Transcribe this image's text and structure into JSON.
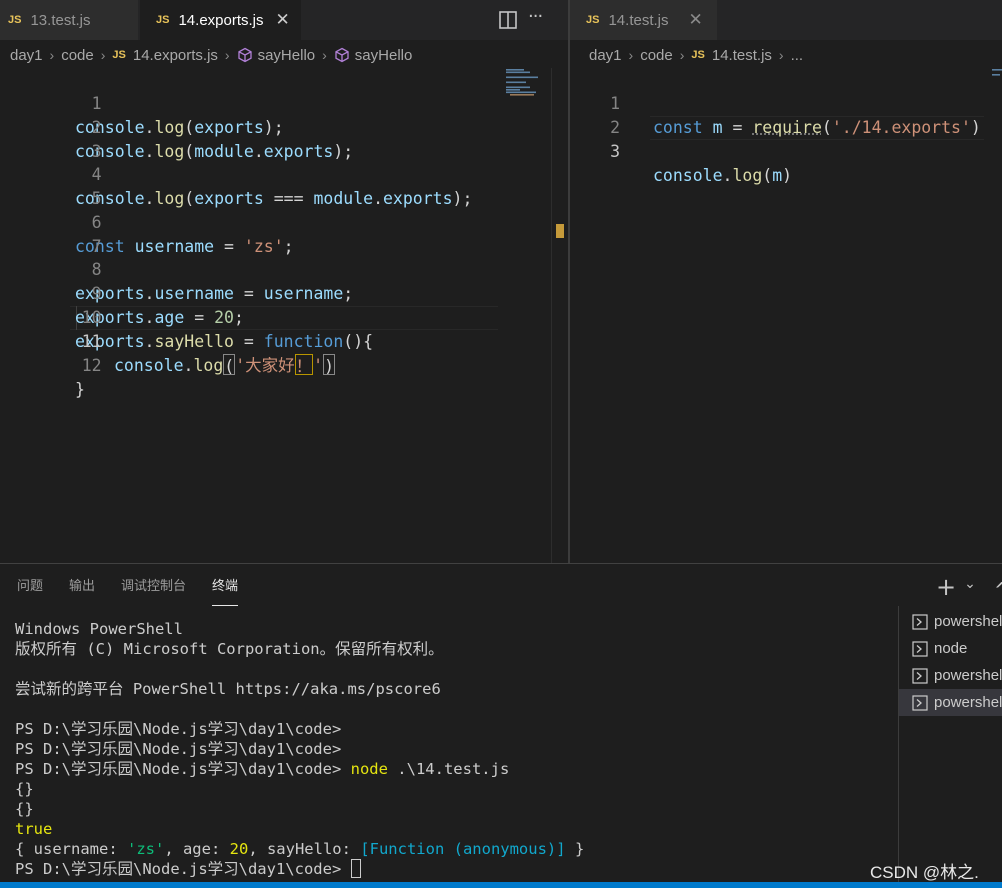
{
  "left_editor": {
    "tabs": [
      {
        "badge": "JS",
        "label": "13.test.js",
        "active": false
      },
      {
        "badge": "JS",
        "label": "14.exports.js",
        "active": true,
        "close": "✕"
      }
    ],
    "toolbar": {
      "split_icon": "split-editor-icon",
      "more_icon": "more-actions-icon",
      "more": "···"
    },
    "breadcrumb": [
      "day1",
      "code",
      "14.exports.js",
      "sayHello",
      "sayHello"
    ],
    "breadcrumb_js": "JS",
    "line_numbers": [
      "1",
      "2",
      "3",
      "4",
      "5",
      "6",
      "7",
      "8",
      "9",
      "10",
      "11",
      "12"
    ],
    "current_line": "11",
    "code": {
      "l1": {
        "a": "console",
        "b": ".",
        "c": "log",
        "d": "(",
        "e": "exports",
        "f": ");"
      },
      "l2": {
        "a": "console",
        "b": ".",
        "c": "log",
        "d": "(",
        "e": "module",
        "f": ".",
        "g": "exports",
        "h": ");"
      },
      "l4": {
        "a": "console",
        "b": ".",
        "c": "log",
        "d": "(",
        "e": "exports",
        "f": " === ",
        "g": "module",
        "h": ".",
        "i": "exports",
        "j": ");"
      },
      "l6": {
        "a": "const",
        "b": " ",
        "c": "username",
        "d": " = ",
        "e": "'zs'",
        "f": ";"
      },
      "l8": {
        "a": "exports",
        "b": ".",
        "c": "username",
        "d": " = ",
        "e": "username",
        "f": ";"
      },
      "l9": {
        "a": "exports",
        "b": ".",
        "c": "age",
        "d": " = ",
        "e": "20",
        "f": ";"
      },
      "l10": {
        "a": "exports",
        "b": ".",
        "c": "sayHello",
        "d": " = ",
        "e": "function",
        "f": "(){"
      },
      "l11": {
        "a": "console",
        "b": ".",
        "c": "log",
        "d": "(",
        "e": "'大家好",
        "f": "！",
        "g": "'",
        "h": ")"
      },
      "l12": {
        "a": "}"
      }
    }
  },
  "right_editor": {
    "tabs": [
      {
        "badge": "JS",
        "label": "14.test.js",
        "active": false,
        "close": "✕"
      }
    ],
    "breadcrumb": [
      "day1",
      "code",
      "14.test.js",
      "..."
    ],
    "breadcrumb_js": "JS",
    "line_numbers": [
      "1",
      "2",
      "3"
    ],
    "current_line": "3",
    "code": {
      "l1": {
        "a": "const",
        "b": " ",
        "c": "m",
        "d": " = ",
        "e": "require",
        "f": "(",
        "g": "'./14.exports'",
        "h": ")"
      },
      "l3": {
        "a": "console",
        "b": ".",
        "c": "log",
        "d": "(",
        "e": "m",
        "f": ")"
      }
    }
  },
  "panel": {
    "tabs": [
      "问题",
      "输出",
      "调试控制台",
      "终端"
    ],
    "active_tab": "终端",
    "actions": {
      "add": "+",
      "dropdown": "⌄",
      "maximize": "^"
    },
    "terminal": {
      "line1": "Windows PowerShell",
      "line2": "版权所有 (C) Microsoft Corporation。保留所有权利。",
      "line3": "",
      "line4": "尝试新的跨平台 PowerShell https://aka.ms/pscore6",
      "line5": "",
      "line6": "PS D:\\学习乐园\\Node.js学习\\day1\\code>",
      "line7": "PS D:\\学习乐园\\Node.js学习\\day1\\code>",
      "line8_prompt": "PS D:\\学习乐园\\Node.js学习\\day1\\code> ",
      "line8_cmd": "node",
      "line8_arg": " .\\14.test.js",
      "line9": "{}",
      "line10": "{}",
      "line11": "true",
      "line12": {
        "a": "{ username: ",
        "b": "'zs'",
        "c": ", age: ",
        "d": "20",
        "e": ", sayHello: ",
        "f": "[Function (anonymous)]",
        "g": " }"
      },
      "line13_prompt": "PS D:\\学习乐园\\Node.js学习\\day1\\code> "
    },
    "terminal_list": [
      {
        "label": "powershell",
        "selected": false
      },
      {
        "label": "node",
        "selected": false
      },
      {
        "label": "powershell",
        "selected": false
      },
      {
        "label": "powershell",
        "selected": true
      }
    ]
  },
  "watermark": "CSDN @林之.",
  "colors": {
    "accent": "#007acc",
    "js_badge": "#e8c35a",
    "keyword": "#569cd6",
    "string": "#ce9178",
    "function": "#dcdcaa",
    "variable": "#9cdcfe",
    "number": "#b5cea8"
  }
}
